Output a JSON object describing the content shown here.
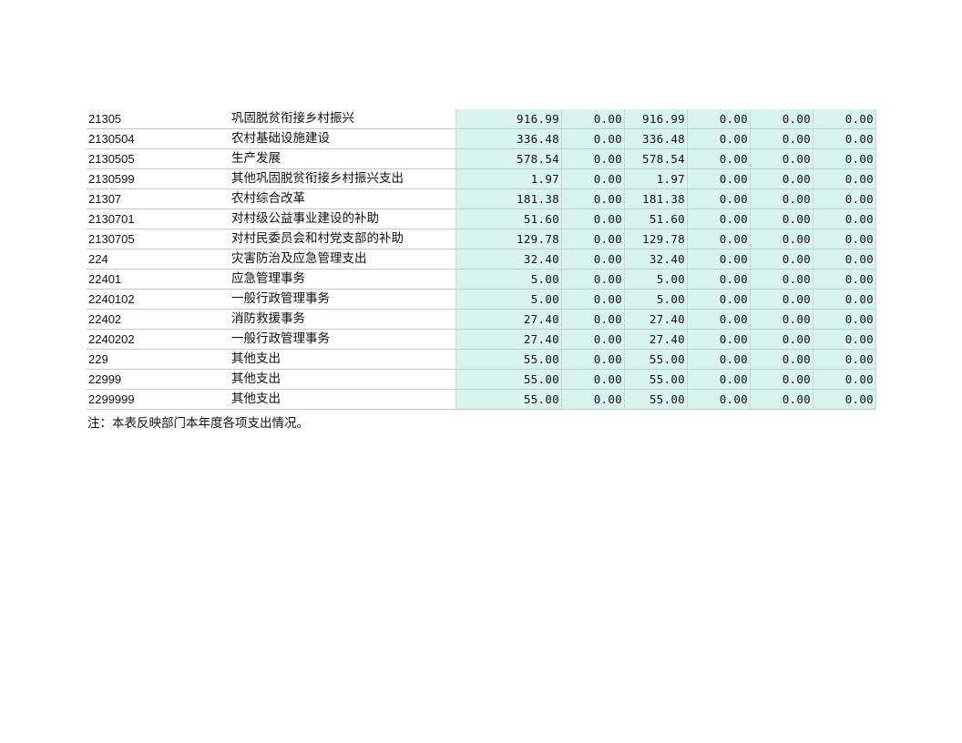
{
  "rows": [
    {
      "code": "21305",
      "name": "巩固脱贫衔接乡村振兴",
      "v1": "916.99",
      "v2": "0.00",
      "v3": "916.99",
      "v4": "0.00",
      "v5": "0.00",
      "v6": "0.00"
    },
    {
      "code": "2130504",
      "name": "农村基础设施建设",
      "v1": "336.48",
      "v2": "0.00",
      "v3": "336.48",
      "v4": "0.00",
      "v5": "0.00",
      "v6": "0.00"
    },
    {
      "code": "2130505",
      "name": "生产发展",
      "v1": "578.54",
      "v2": "0.00",
      "v3": "578.54",
      "v4": "0.00",
      "v5": "0.00",
      "v6": "0.00"
    },
    {
      "code": "2130599",
      "name": "其他巩固脱贫衔接乡村振兴支出",
      "v1": "1.97",
      "v2": "0.00",
      "v3": "1.97",
      "v4": "0.00",
      "v5": "0.00",
      "v6": "0.00"
    },
    {
      "code": "21307",
      "name": "农村综合改革",
      "v1": "181.38",
      "v2": "0.00",
      "v3": "181.38",
      "v4": "0.00",
      "v5": "0.00",
      "v6": "0.00"
    },
    {
      "code": "2130701",
      "name": "对村级公益事业建设的补助",
      "v1": "51.60",
      "v2": "0.00",
      "v3": "51.60",
      "v4": "0.00",
      "v5": "0.00",
      "v6": "0.00"
    },
    {
      "code": "2130705",
      "name": "对村民委员会和村党支部的补助",
      "v1": "129.78",
      "v2": "0.00",
      "v3": "129.78",
      "v4": "0.00",
      "v5": "0.00",
      "v6": "0.00"
    },
    {
      "code": "224",
      "name": "灾害防治及应急管理支出",
      "v1": "32.40",
      "v2": "0.00",
      "v3": "32.40",
      "v4": "0.00",
      "v5": "0.00",
      "v6": "0.00"
    },
    {
      "code": "22401",
      "name": "应急管理事务",
      "v1": "5.00",
      "v2": "0.00",
      "v3": "5.00",
      "v4": "0.00",
      "v5": "0.00",
      "v6": "0.00"
    },
    {
      "code": "2240102",
      "name": "一般行政管理事务",
      "v1": "5.00",
      "v2": "0.00",
      "v3": "5.00",
      "v4": "0.00",
      "v5": "0.00",
      "v6": "0.00"
    },
    {
      "code": "22402",
      "name": "消防救援事务",
      "v1": "27.40",
      "v2": "0.00",
      "v3": "27.40",
      "v4": "0.00",
      "v5": "0.00",
      "v6": "0.00"
    },
    {
      "code": "2240202",
      "name": "一般行政管理事务",
      "v1": "27.40",
      "v2": "0.00",
      "v3": "27.40",
      "v4": "0.00",
      "v5": "0.00",
      "v6": "0.00"
    },
    {
      "code": "229",
      "name": "其他支出",
      "v1": "55.00",
      "v2": "0.00",
      "v3": "55.00",
      "v4": "0.00",
      "v5": "0.00",
      "v6": "0.00"
    },
    {
      "code": "22999",
      "name": "其他支出",
      "v1": "55.00",
      "v2": "0.00",
      "v3": "55.00",
      "v4": "0.00",
      "v5": "0.00",
      "v6": "0.00"
    },
    {
      "code": "2299999",
      "name": "其他支出",
      "v1": "55.00",
      "v2": "0.00",
      "v3": "55.00",
      "v4": "0.00",
      "v5": "0.00",
      "v6": "0.00"
    }
  ],
  "note": "注：本表反映部门本年度各项支出情况。",
  "colors": {
    "value_cell_bg": "#d9f3ee",
    "row_border": "#c9c9c9"
  }
}
